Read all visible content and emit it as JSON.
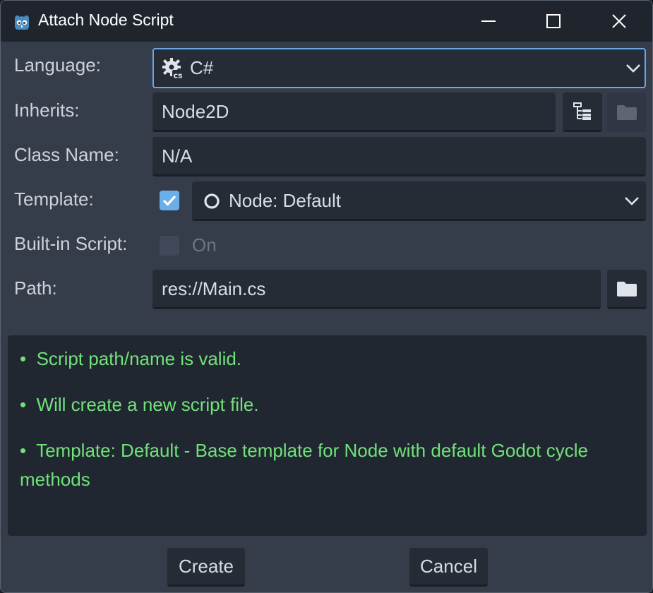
{
  "window": {
    "title": "Attach Node Script",
    "controls": [
      "minimize-icon",
      "maximize-icon",
      "close-icon"
    ]
  },
  "form": {
    "language": {
      "label": "Language:",
      "value": "C#",
      "icon": "csharp-gear-icon"
    },
    "inherits": {
      "label": "Inherits:",
      "value": "Node2D",
      "tree_button_icon": "class-tree-icon",
      "browse_button_icon": "folder-icon"
    },
    "class_name": {
      "label": "Class Name:",
      "value": "N/A"
    },
    "template": {
      "label": "Template:",
      "checked": true,
      "value": "Node: Default",
      "icon": "node-circle-icon"
    },
    "builtin_script": {
      "label": "Built-in Script:",
      "checked": false,
      "option_label": "On"
    },
    "path": {
      "label": "Path:",
      "value": "res://Main.cs",
      "browse_button_icon": "folder-icon"
    }
  },
  "status": {
    "bullet": "•",
    "lines": [
      "Script path/name is valid.",
      "Will create a new script file.",
      "Template: Default - Base template for Node with default Godot cycle methods"
    ]
  },
  "actions": {
    "create_label": "Create",
    "cancel_label": "Cancel"
  },
  "colors": {
    "accent": "#6ba6e8",
    "status_ok": "#70e27a",
    "panel_bg": "#363d4a",
    "titlebar_bg": "#20252d"
  }
}
